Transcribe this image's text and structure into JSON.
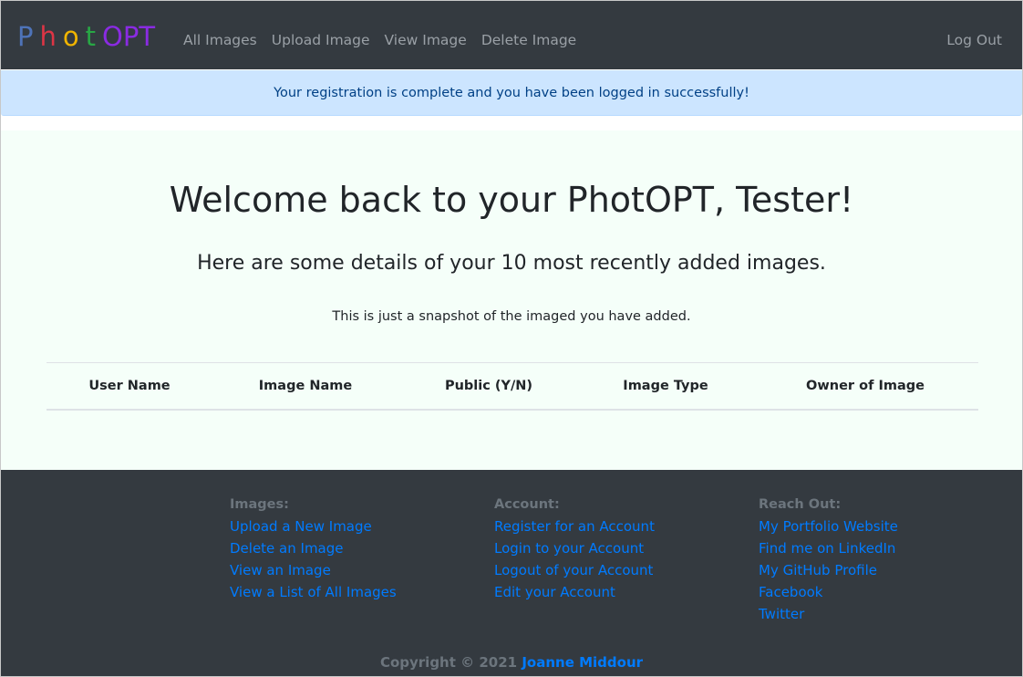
{
  "brand": {
    "letters": [
      {
        "char": "P",
        "color": "#4e73b8"
      },
      {
        "char": "h",
        "color": "#dc3545"
      },
      {
        "char": "o",
        "color": "#f0b400"
      },
      {
        "char": "t",
        "color": "#28a745"
      },
      {
        "char": "OPT",
        "color": "#8a2be2"
      }
    ]
  },
  "nav": {
    "links": [
      "All Images",
      "Upload Image",
      "View Image",
      "Delete Image"
    ],
    "logout": "Log Out"
  },
  "alert": {
    "message": "Your registration is complete and you have been logged in successfully!",
    "bg_color": "#cce5ff"
  },
  "main": {
    "welcome": "Welcome back to your PhotOPT, Tester!",
    "subhead": "Here are some details of your 10 most recently added images.",
    "snapshot": "This is just a snapshot of the imaged you have added.",
    "table_headers": [
      "User Name",
      "Image Name",
      "Public (Y/N)",
      "Image Type",
      "Owner of Image"
    ]
  },
  "footer": {
    "columns": [
      {
        "heading": "Images:",
        "links": [
          "Upload a New Image",
          "Delete an Image",
          "View an Image",
          "View a List of All Images"
        ]
      },
      {
        "heading": "Account:",
        "links": [
          "Register for an Account",
          "Login to your Account",
          "Logout of your Account",
          "Edit your Account"
        ]
      },
      {
        "heading": "Reach Out:",
        "links": [
          "My Portfolio Website",
          "Find me on LinkedIn",
          "My GitHub Profile",
          "Facebook",
          "Twitter"
        ]
      }
    ],
    "copyright_prefix": "Copyright © 2021",
    "copyright_name": "Joanne Middour"
  }
}
